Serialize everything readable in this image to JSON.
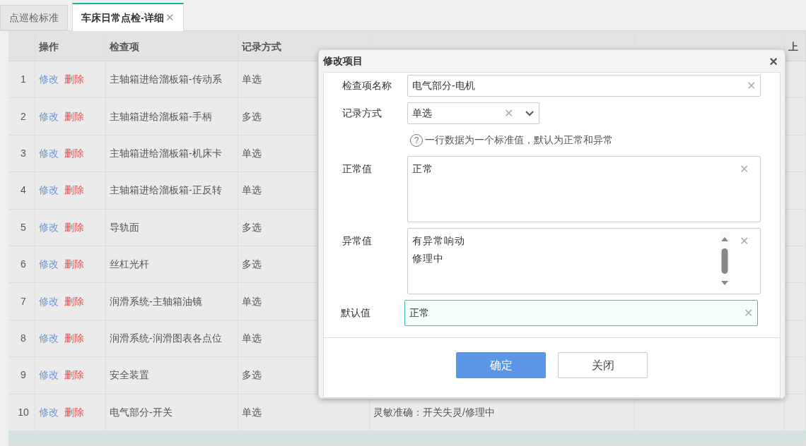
{
  "tabs": [
    {
      "label": "点巡检标准",
      "selected": false
    },
    {
      "label": "车床日常点检-详细",
      "selected": true,
      "close_icon": "✕"
    }
  ],
  "table": {
    "columns": [
      {
        "label": "操作"
      },
      {
        "label": "检查项"
      },
      {
        "label": "记录方式"
      },
      {},
      {},
      {
        "label": "上"
      }
    ],
    "rows": [
      {
        "number": "1",
        "edit": "修改",
        "delete": "删除",
        "item": "主轴箱进给溜板箱-传动系",
        "method": "单选",
        "selected": false
      },
      {
        "number": "2",
        "edit": "修改",
        "delete": "删除",
        "item": "主轴箱进给溜板箱-手柄",
        "method": "多选",
        "selected": false
      },
      {
        "number": "3",
        "edit": "修改",
        "delete": "删除",
        "item": "主轴箱进给溜板箱-机床卡",
        "method": "单选",
        "selected": false
      },
      {
        "number": "4",
        "edit": "修改",
        "delete": "删除",
        "item": "主轴箱进给溜板箱-正反转",
        "method": "单选",
        "selected": false
      },
      {
        "number": "5",
        "edit": "修改",
        "delete": "删除",
        "item": "导轨面",
        "method": "多选",
        "selected": false
      },
      {
        "number": "6",
        "edit": "修改",
        "delete": "删除",
        "item": "丝杠光杆",
        "method": "多选",
        "selected": false
      },
      {
        "number": "7",
        "edit": "修改",
        "delete": "删除",
        "item": "润滑系统-主轴箱油镜",
        "method": "单选",
        "selected": false
      },
      {
        "number": "8",
        "edit": "修改",
        "delete": "删除",
        "item": "润滑系统-润滑图表各点位",
        "method": "单选",
        "selected": false
      },
      {
        "number": "9",
        "edit": "修改",
        "delete": "删除",
        "item": "安全装置",
        "method": "多选",
        "selected": false
      },
      {
        "number": "10",
        "edit": "修改",
        "delete": "删除",
        "item": "电气部分-开关",
        "method": "单选",
        "result": "灵敏准确：开关失灵/修理中",
        "selected": false
      },
      {
        "selected": true
      }
    ]
  },
  "dialog": {
    "title": "修改项目",
    "close": "×",
    "name": {
      "label": "检查项名称",
      "value": "电气部分-电机",
      "clear_icon": "✕"
    },
    "record": {
      "label": "记录方式",
      "value": "单选",
      "clear_icon": "✕"
    },
    "hint": {
      "icon": "?",
      "text": "一行数据为一个标准值，默认为正常和异常"
    },
    "normal": {
      "label": "正常值",
      "lines": [
        "正常"
      ],
      "clear_icon": "✕"
    },
    "abnormal": {
      "label": "异常值",
      "lines": [
        "有异常响动",
        "修理中"
      ],
      "clear_icon": "✕"
    },
    "default": {
      "label": "默认值",
      "value": "正常",
      "focused": true,
      "clear_icon": "✕"
    },
    "buttons": [
      "确定",
      "关闭"
    ]
  }
}
